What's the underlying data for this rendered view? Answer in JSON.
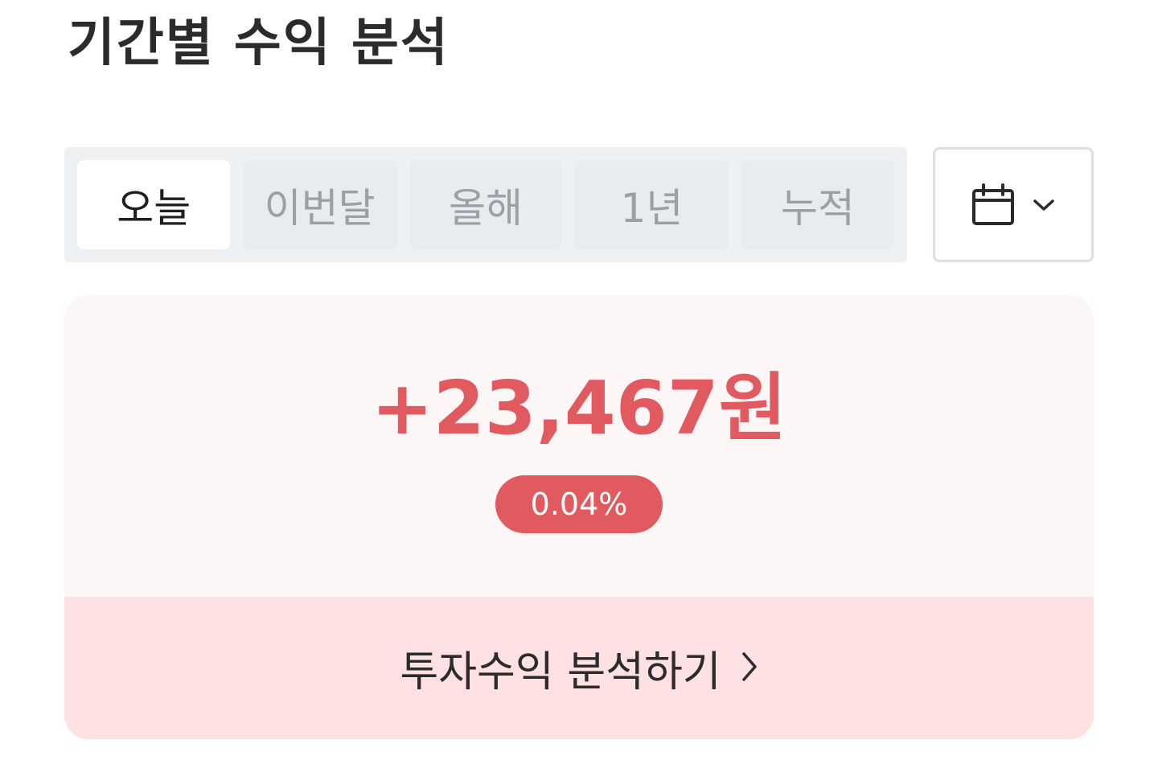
{
  "page": {
    "title": "기간별 수익 분석"
  },
  "period_tabs": {
    "items": [
      {
        "label": "오늘",
        "active": true
      },
      {
        "label": "이번달",
        "active": false
      },
      {
        "label": "올해",
        "active": false
      },
      {
        "label": "1년",
        "active": false
      },
      {
        "label": "누적",
        "active": false
      }
    ]
  },
  "date_picker": {
    "icon": "calendar-icon",
    "chevron_icon": "chevron-down-icon"
  },
  "summary": {
    "amount": "+23,467원",
    "rate": "0.04%",
    "accent_color": "#e05a60"
  },
  "analyze": {
    "label": "투자수익 분석하기",
    "chevron_icon": "chevron-right-icon"
  }
}
